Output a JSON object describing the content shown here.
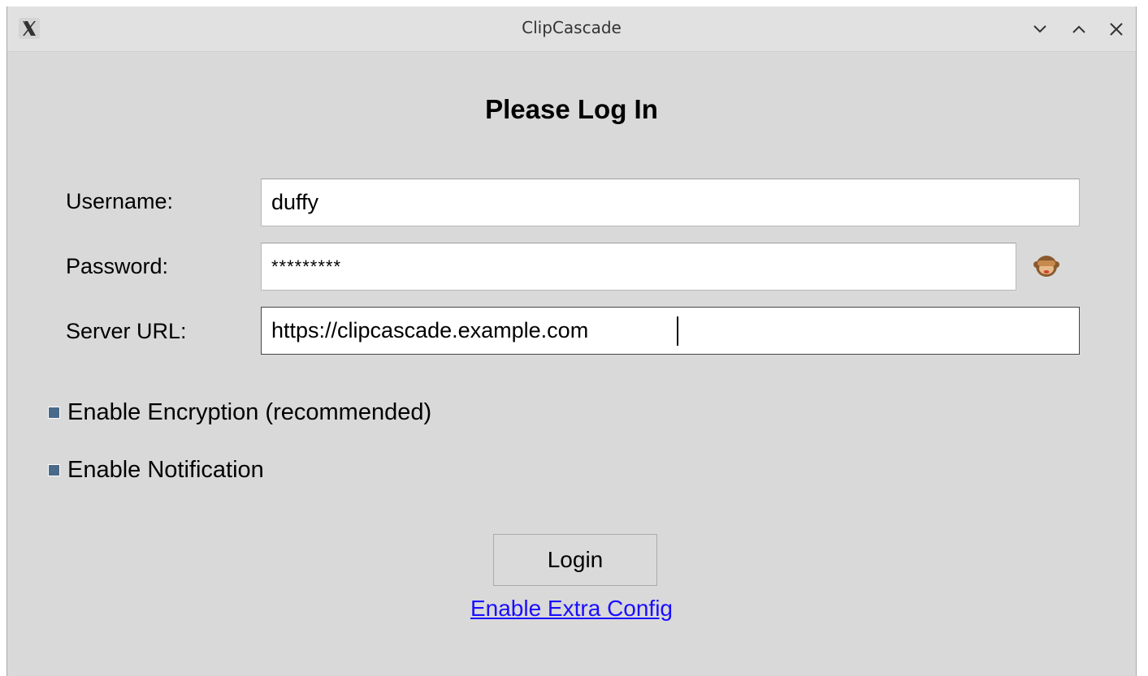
{
  "window": {
    "title": "ClipCascade",
    "icon": "x-app-icon",
    "controls": [
      "minimize-icon",
      "maximize-icon",
      "close-icon"
    ]
  },
  "form": {
    "heading": "Please Log In",
    "username_label": "Username:",
    "username_value": "duffy",
    "password_label": "Password:",
    "password_value": "*********",
    "password_toggle_icon": "see-no-evil-monkey-icon",
    "server_url_label": "Server URL:",
    "server_url_value": "https://clipcascade.example.com"
  },
  "options": {
    "encryption_label": "Enable Encryption (recommended)",
    "notification_label": "Enable Notification"
  },
  "actions": {
    "login_label": "Login",
    "extra_config_label": "Enable Extra Config"
  },
  "colors": {
    "window_bg": "#d9d9d9",
    "titlebar_bg": "#e1e1e1",
    "checkbox": "#4a6a8a",
    "link": "#1a0dff"
  }
}
